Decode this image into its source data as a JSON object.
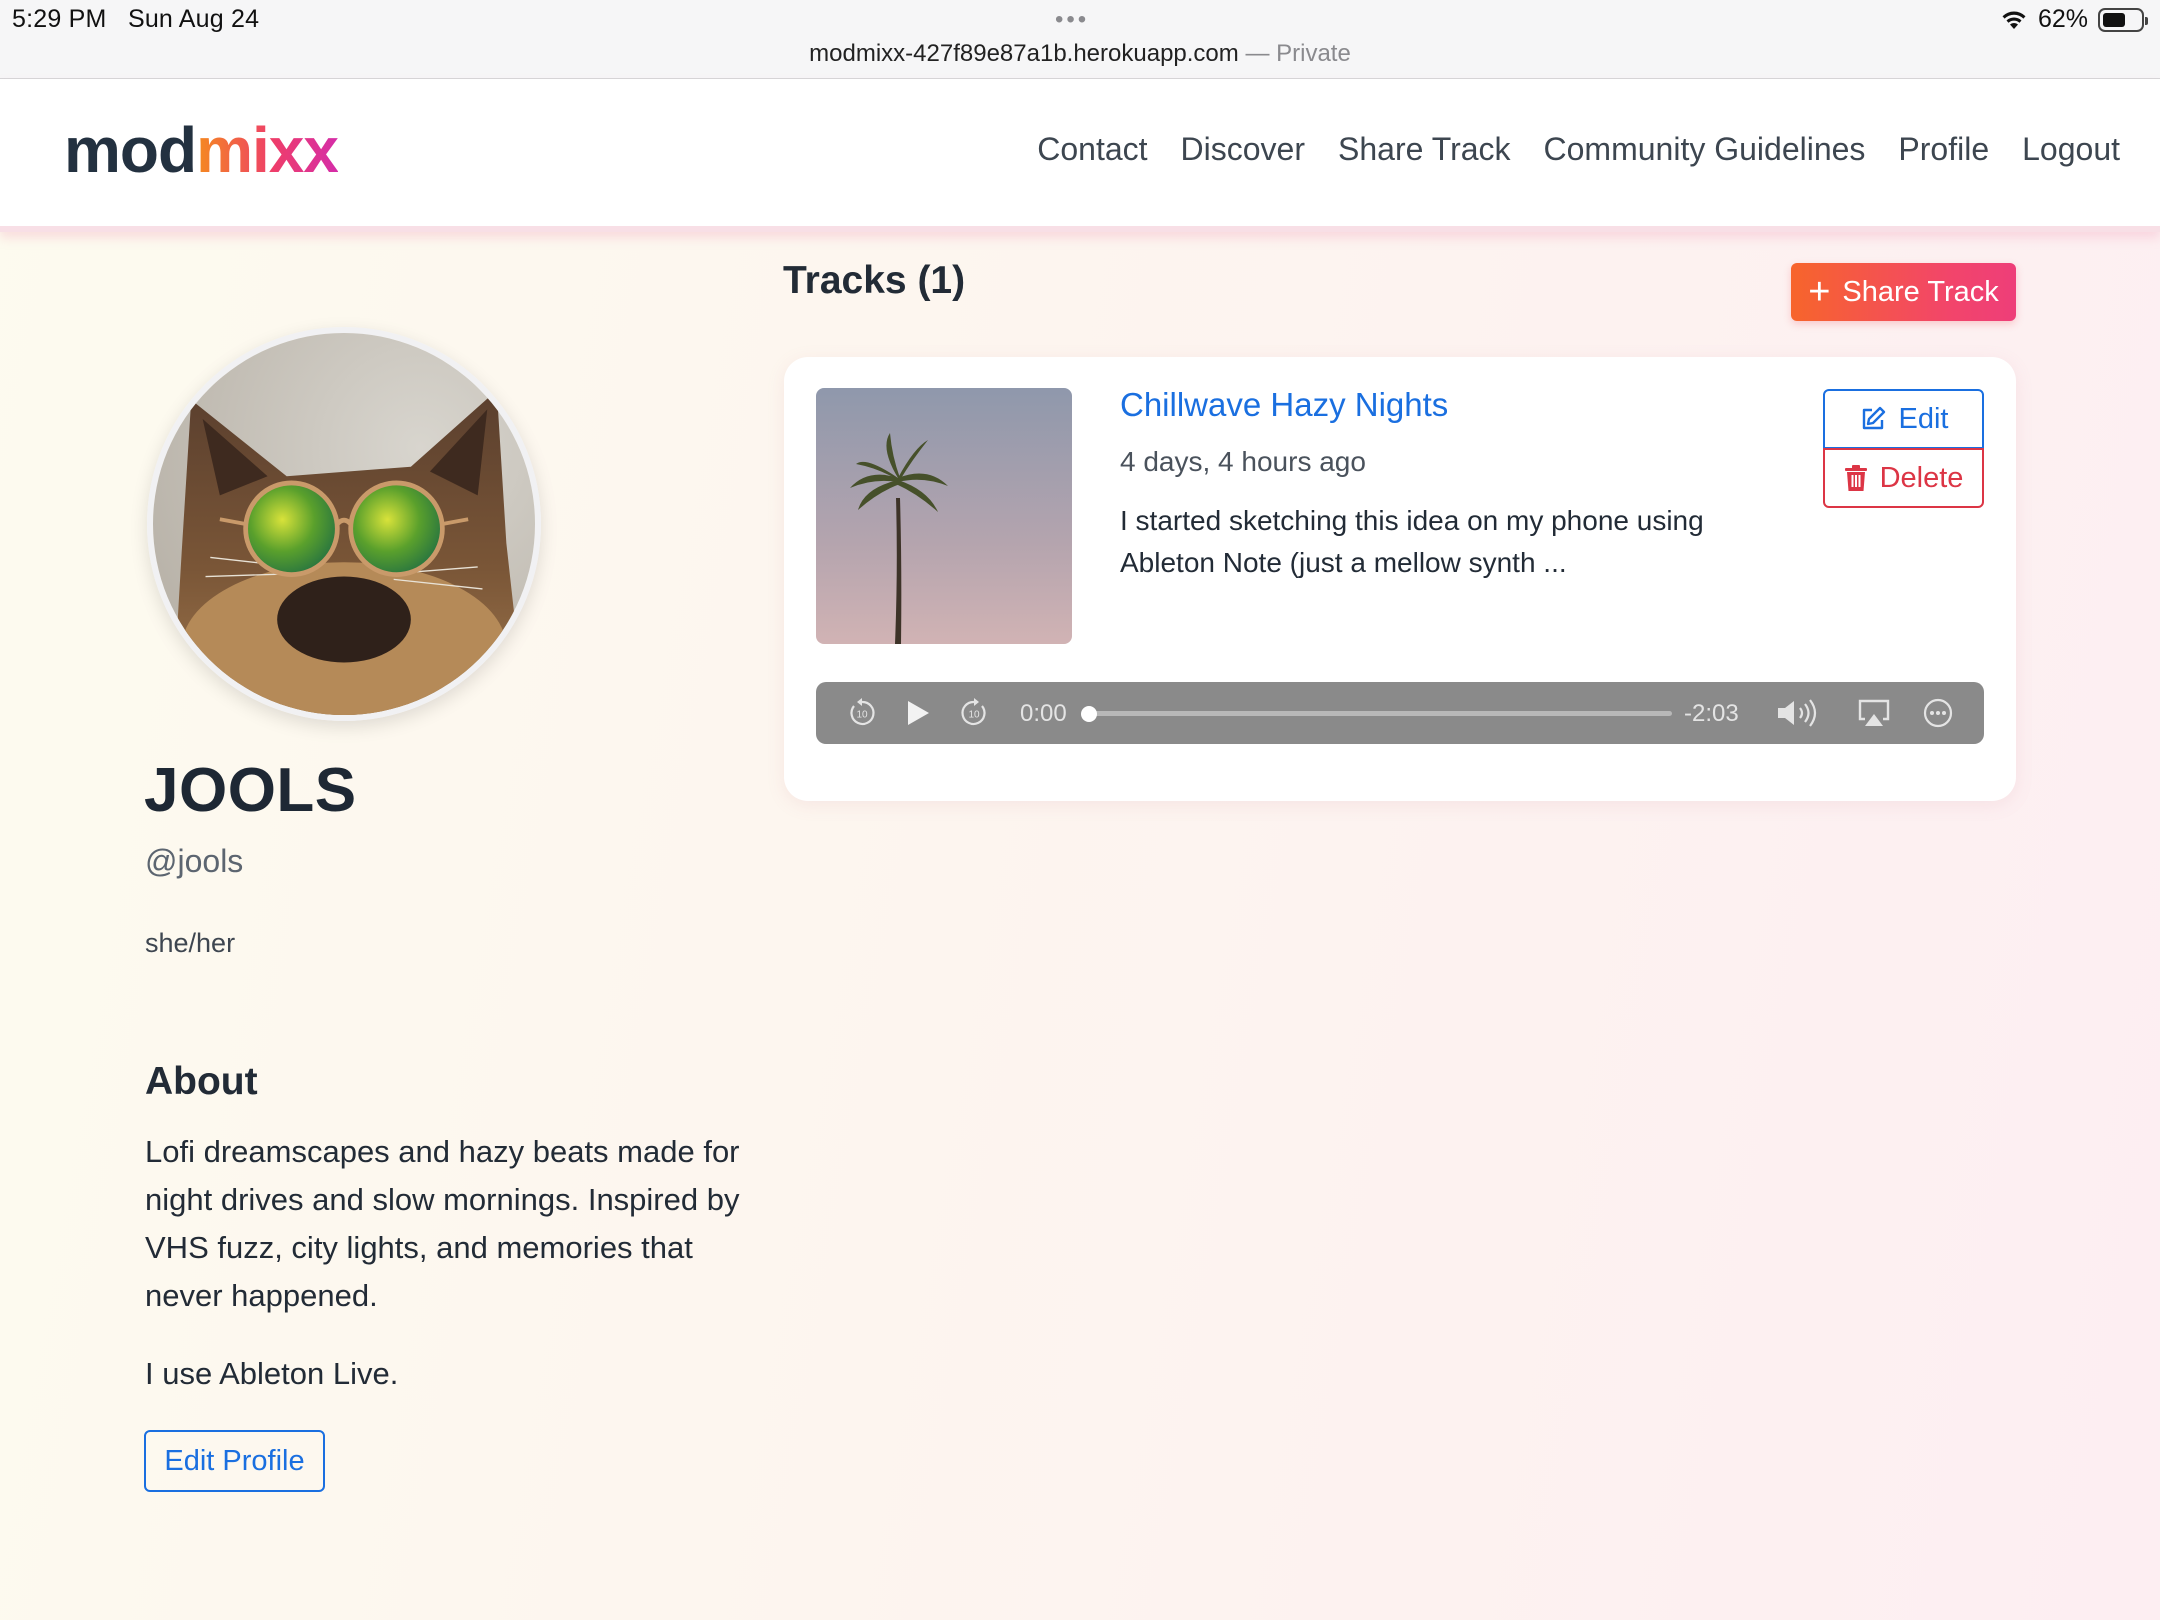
{
  "status_bar": {
    "time": "5:29 PM",
    "date": "Sun Aug 24",
    "url": "modmixx-427f89e87a1b.herokuapp.com",
    "url_suffix": "— Private",
    "battery": "62%",
    "battery_level": 0.62
  },
  "header": {
    "logo_part1": "mod",
    "logo_part2": "mixx",
    "nav": [
      "Contact",
      "Discover",
      "Share Track",
      "Community Guidelines",
      "Profile",
      "Logout"
    ]
  },
  "profile": {
    "display_name": "JOOLS",
    "handle": "@jools",
    "pronouns": "she/her",
    "about_heading": "About",
    "about_paragraph_1": "Lofi dreamscapes and hazy beats made for night drives and slow mornings. Inspired by VHS fuzz, city lights, and memories that never happened.",
    "about_paragraph_2": "I use Ableton Live.",
    "edit_profile_label": "Edit Profile"
  },
  "tracks": {
    "heading": "Tracks (1)",
    "share_button_label": "Share Track",
    "items": [
      {
        "title": "Chillwave Hazy Nights",
        "posted": "4 days, 4 hours ago",
        "description": "I started sketching this idea on my phone using Ableton Note (just a mellow synth ...",
        "edit_label": "Edit",
        "delete_label": "Delete",
        "player": {
          "elapsed": "0:00",
          "remaining": "-2:03",
          "skip_back_seconds": "10",
          "skip_forward_seconds": "10",
          "progress": 0
        }
      }
    ]
  },
  "colors": {
    "accent_blue": "#1a6fe0",
    "danger_red": "#dc3545",
    "brand_orange": "#f7652b",
    "brand_pink": "#ee3e79",
    "text_dark": "#222b36"
  },
  "icons": [
    "wifi-icon",
    "battery-icon",
    "plus-icon",
    "edit-icon",
    "trash-icon",
    "skip-back-icon",
    "play-icon",
    "skip-forward-icon",
    "volume-icon",
    "airplay-icon",
    "more-icon"
  ]
}
